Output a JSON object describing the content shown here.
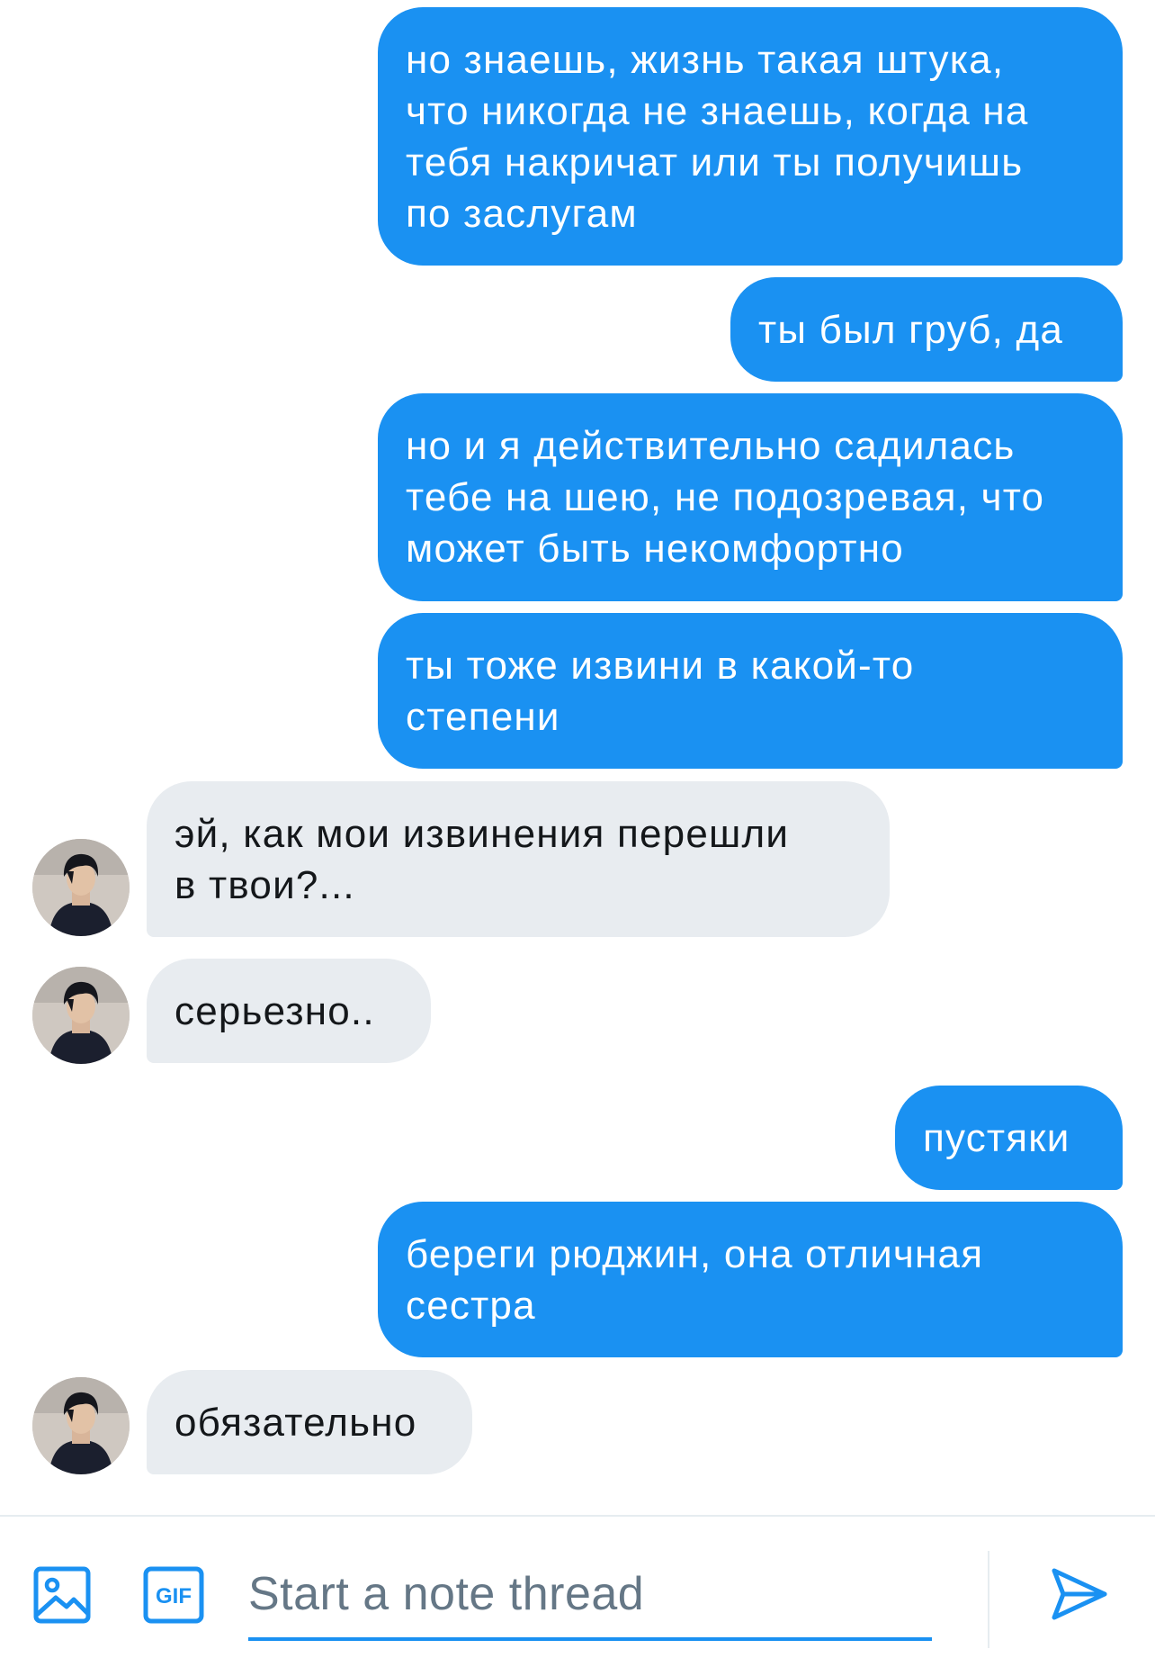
{
  "messages": [
    {
      "from": "me",
      "text": "но знаешь, жизнь такая штука,\nчто никогда не знаешь, когда на\nтебя накричат или ты получишь\nпо заслугам"
    },
    {
      "from": "me",
      "text": "ты был груб, да"
    },
    {
      "from": "me",
      "text": "но и я действительно садилась\nтебе на шею, не подозревая, что\nможет быть некомфортно"
    },
    {
      "from": "me",
      "text": "ты тоже извини в какой-то\nстепени"
    },
    {
      "from": "them",
      "text": "эй, как мои извинения перешли\nв твои?..."
    },
    {
      "from": "them",
      "text": "серьезно.."
    },
    {
      "from": "me",
      "text": "пустяки"
    },
    {
      "from": "me",
      "text": "береги рюджин, она отличная\nсестра"
    },
    {
      "from": "them",
      "text": "обязательно"
    }
  ],
  "composer": {
    "placeholder": "Start a note thread",
    "media_icon": "image-icon",
    "gif_icon": "gif-icon",
    "gif_label": "GIF",
    "send_icon": "send-icon"
  },
  "colors": {
    "accent": "#1a91f2",
    "incoming_bubble": "#e8ecf0",
    "incoming_text": "#14171a",
    "placeholder": "#657786",
    "divider": "#e6ecf0"
  }
}
